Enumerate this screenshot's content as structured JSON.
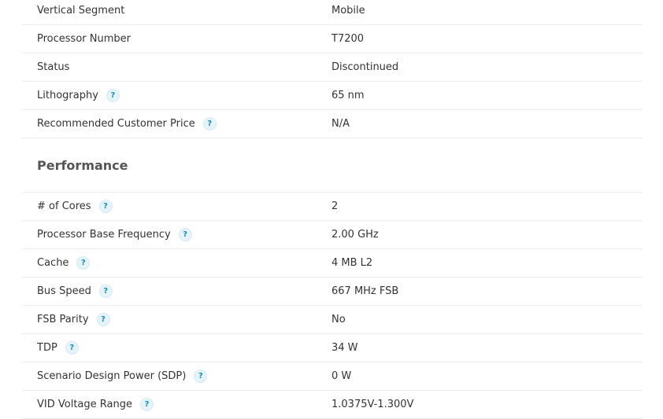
{
  "colors": {
    "help_icon": "#1a8fbf",
    "divider": "#ececec"
  },
  "sections": [
    {
      "title": "",
      "rows": [
        {
          "label": "Vertical Segment",
          "value": "Mobile",
          "help": false
        },
        {
          "label": "Processor Number",
          "value": "T7200",
          "help": false
        },
        {
          "label": "Status",
          "value": "Discontinued",
          "help": false
        },
        {
          "label": "Lithography",
          "value": "65 nm",
          "help": true
        },
        {
          "label": "Recommended Customer Price",
          "value": "N/A",
          "help": true
        }
      ]
    },
    {
      "title": "Performance",
      "rows": [
        {
          "label": "# of Cores",
          "value": "2",
          "help": true
        },
        {
          "label": "Processor Base Frequency",
          "value": "2.00 GHz",
          "help": true
        },
        {
          "label": "Cache",
          "value": "4 MB L2",
          "help": true
        },
        {
          "label": "Bus Speed",
          "value": "667 MHz FSB",
          "help": true
        },
        {
          "label": "FSB Parity",
          "value": "No",
          "help": true
        },
        {
          "label": "TDP",
          "value": "34 W",
          "help": true
        },
        {
          "label": "Scenario Design Power (SDP)",
          "value": "0 W",
          "help": true
        },
        {
          "label": "VID Voltage Range",
          "value": "1.0375V-1.300V",
          "help": true
        }
      ]
    }
  ],
  "help_glyph": "?"
}
